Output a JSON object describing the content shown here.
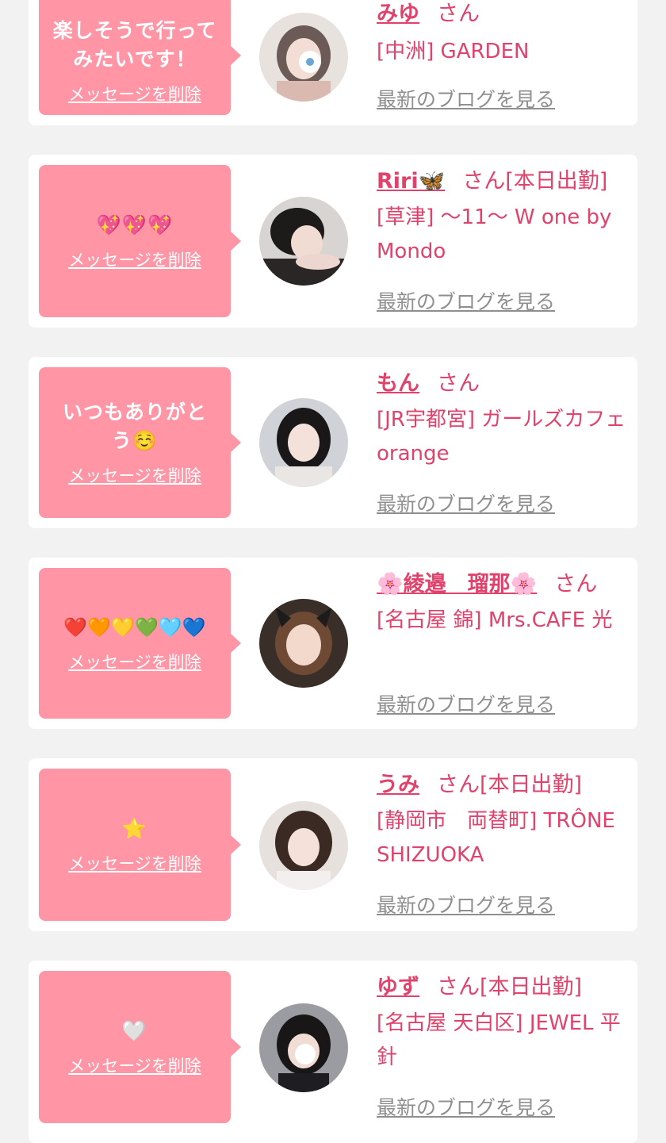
{
  "colors": {
    "accent": "#e0426b",
    "bubble": "#ff95a5",
    "link_gray": "#8f8f8f",
    "background": "#f2f2f2"
  },
  "cards": [
    {
      "message": "楽しそうで行ってみたいです！",
      "delete_label": "メッセージを削除",
      "name": "みゆ",
      "honorific": "さん",
      "status": "",
      "shop": "[中洲] GARDEN",
      "blog_label": "最新のブログを見る"
    },
    {
      "message": "💖💖💖",
      "delete_label": "メッセージを削除",
      "name": "Riri🦋",
      "honorific": "さん",
      "status": "[本日出勤]",
      "shop": "[草津] 〜11〜 W one by Mondo",
      "blog_label": "最新のブログを見る"
    },
    {
      "message": "いつもありがとう☺️",
      "delete_label": "メッセージを削除",
      "name": "もん",
      "honorific": "さん",
      "status": "",
      "shop": "[JR宇都宮] ガールズカフェ orange",
      "blog_label": "最新のブログを見る"
    },
    {
      "message": "❤️🧡💛💚🩵💙",
      "delete_label": "メッセージを削除",
      "name": "🌸綾邉　瑠那🌸",
      "honorific": "さん",
      "status": "",
      "shop": "[名古屋 錦] Mrs.CAFE 光",
      "blog_label": "最新のブログを見る"
    },
    {
      "message": "⭐",
      "delete_label": "メッセージを削除",
      "name": "うみ",
      "honorific": "さん",
      "status": "[本日出勤]",
      "shop": "[静岡市　両替町] TRÔNE SHIZUOKA",
      "blog_label": "最新のブログを見る"
    },
    {
      "message": "🤍",
      "delete_label": "メッセージを削除",
      "name": "ゆず",
      "honorific": "さん",
      "status": "[本日出勤]",
      "shop": "[名古屋 天白区] JEWEL 平針",
      "blog_label": "最新のブログを見る"
    }
  ]
}
